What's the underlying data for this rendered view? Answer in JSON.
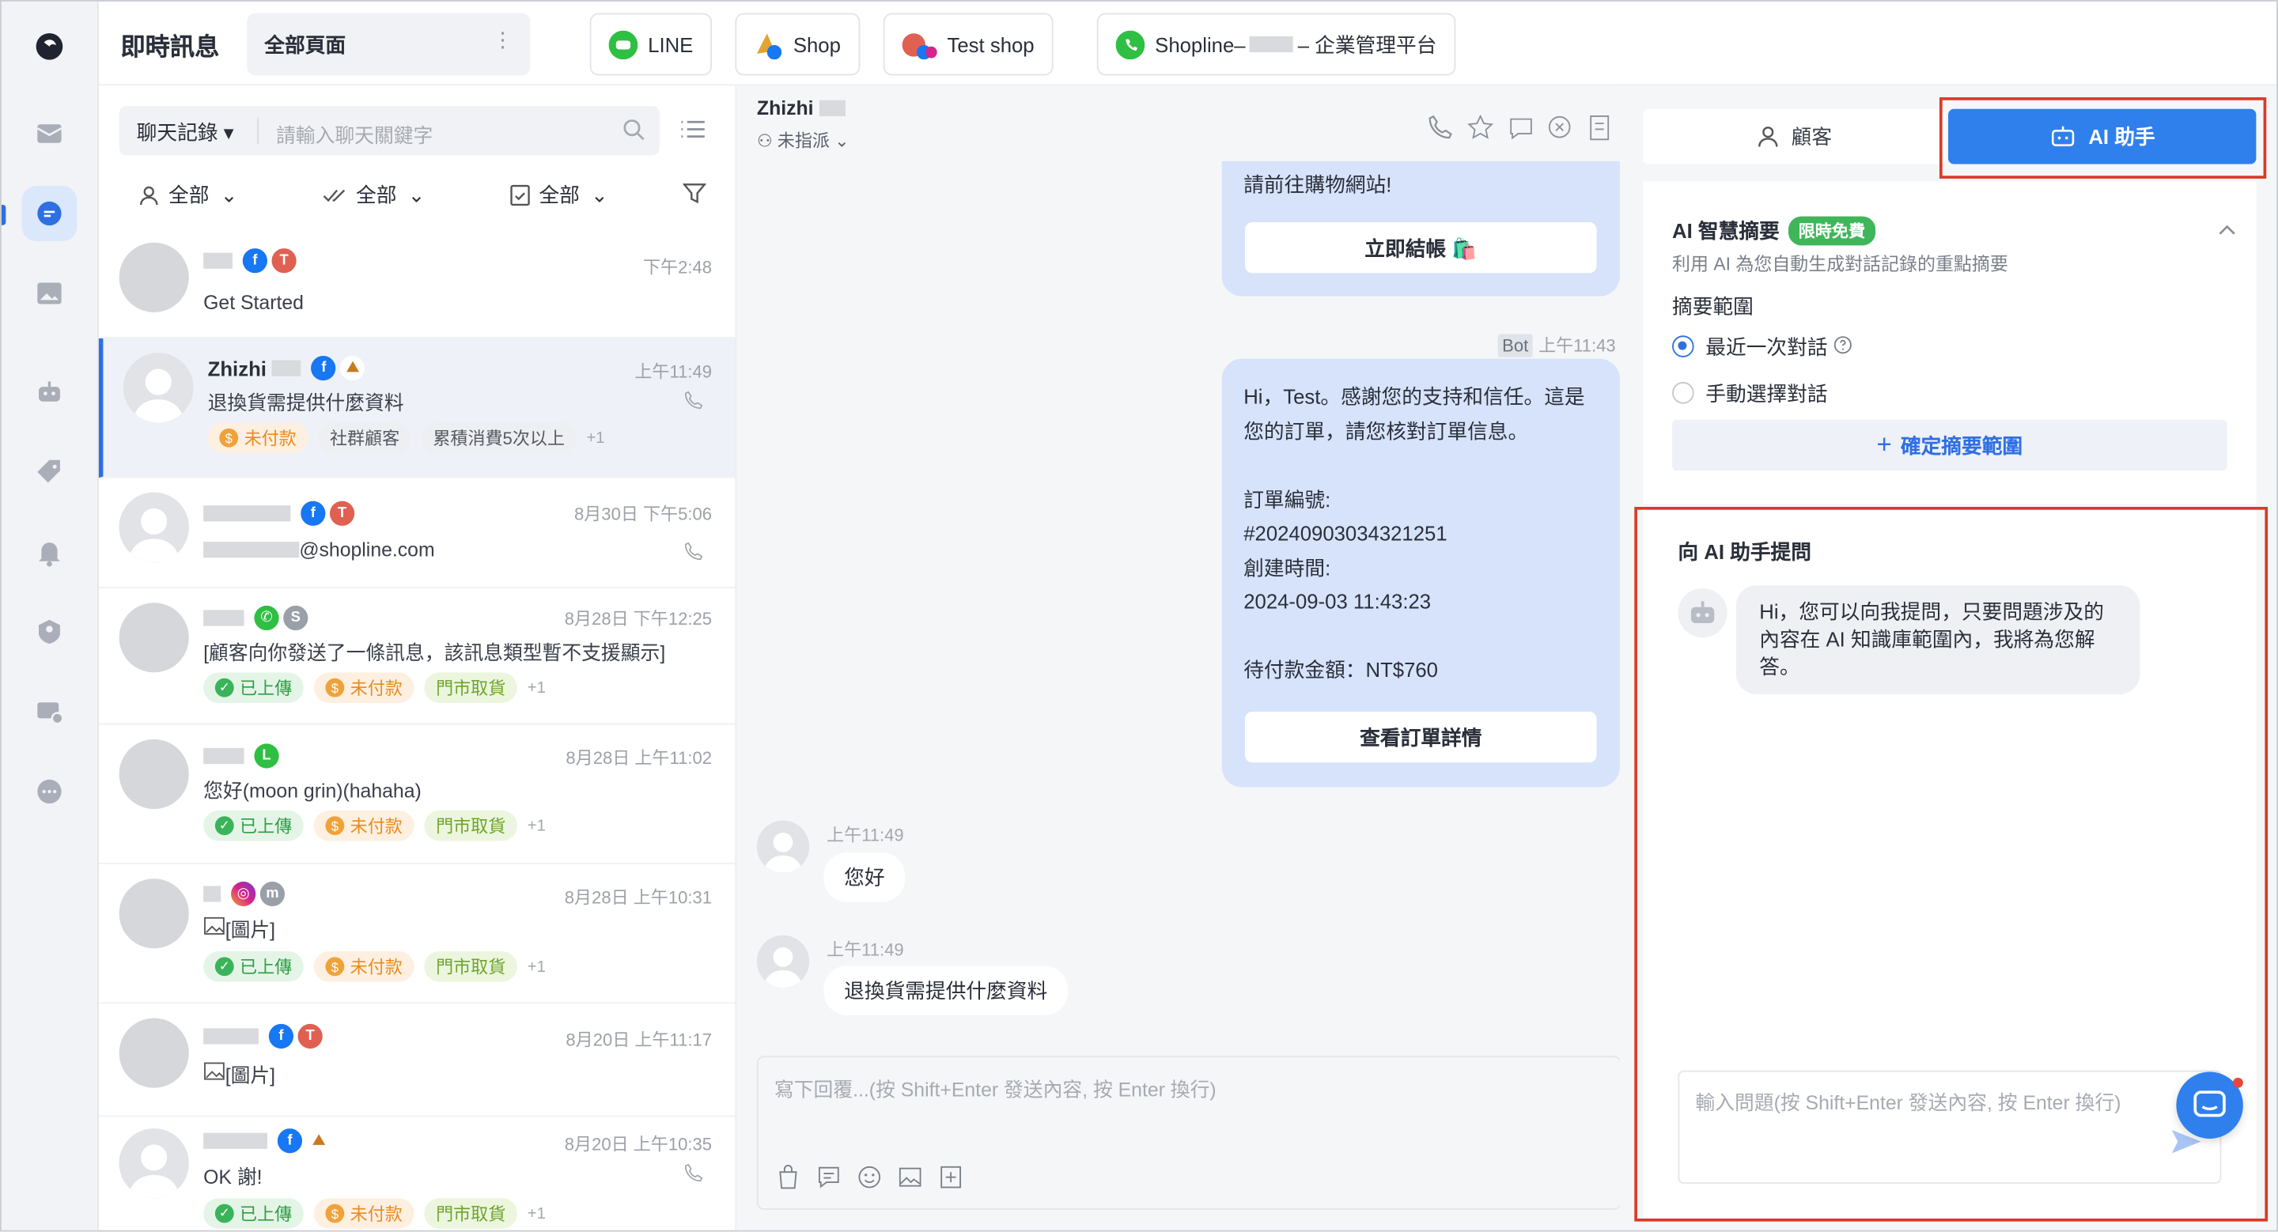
{
  "header": {
    "app_title": "即時訊息",
    "page_select": "全部頁面",
    "page_select_icon": "kebab-icon",
    "channel_tabs": [
      {
        "label": "LINE"
      },
      {
        "label": "Shop"
      },
      {
        "label": "Test shop"
      },
      {
        "label": "Shopline– ",
        "suffix": " – 企業管理平台"
      }
    ]
  },
  "list": {
    "search_type": "聊天記錄",
    "search_placeholder": "請輸入聊天關鍵字",
    "filters": [
      "全部",
      "全部",
      "全部"
    ],
    "rows": [
      {
        "name": "",
        "time": "下午2:48",
        "message": "Get Started"
      },
      {
        "name": "Zhizhi",
        "time": "上午11:49",
        "message": "退換貨需提供什麼資料",
        "tags": [
          "未付款",
          "社群顧客",
          "累積消費5次以上"
        ],
        "more": "+1"
      },
      {
        "name": "",
        "time": "8月30日 下午5:06",
        "message": "@shopline.com"
      },
      {
        "name": "",
        "time": "8月28日 下午12:25",
        "message": "[顧客向你發送了一條訊息，該訊息類型暫不支援顯示]",
        "tags": [
          "已上傳",
          "未付款",
          "門市取貨"
        ],
        "more": "+1"
      },
      {
        "name": "",
        "time": "8月28日 上午11:02",
        "message": "您好(moon grin)(hahaha)",
        "tags": [
          "已上傳",
          "未付款",
          "門市取貨"
        ],
        "more": "+1"
      },
      {
        "name": "",
        "time": "8月28日 上午10:31",
        "message": "[圖片]",
        "tags": [
          "已上傳",
          "未付款",
          "門市取貨"
        ],
        "more": "+1"
      },
      {
        "name": "",
        "time": "8月20日 上午11:17",
        "message": "[圖片]"
      },
      {
        "name": "",
        "time": "8月20日 上午10:35",
        "message": "OK 謝!",
        "tags": [
          "已上傳",
          "未付款",
          "門市取貨"
        ],
        "more": "+1"
      }
    ]
  },
  "chat": {
    "name": "Zhizhi",
    "assign": "未指派",
    "msg1_text": "請前往購物網站!",
    "msg1_button": "立即結帳 🛍️",
    "bot_label": "Bot",
    "bot_time": "上午11:43",
    "msg2_lines": [
      "Hi，Test。感謝您的支持和信任。這是",
      "您的訂單，請您核對訂單信息。",
      "",
      "訂單編號:",
      "#20240903034321251",
      "創建時間:",
      "2024-09-03 11:43:23",
      "",
      "待付款金額：NT$760"
    ],
    "msg2_button": "查看訂單詳情",
    "in1_time": "上午11:49",
    "in1_text": "您好",
    "in2_time": "上午11:49",
    "in2_text": "退換貨需提供什麼資料",
    "composer_placeholder": "寫下回覆...(按 Shift+Enter 發送內容, 按 Enter 換行)"
  },
  "right": {
    "tab_customer": "顧客",
    "tab_ai": "AI 助手",
    "summary_title": "AI 智慧摘要",
    "summary_badge": "限時免費",
    "summary_desc": "利用 AI 為您自動生成對話記錄的重點摘要",
    "range_label": "摘要範圍",
    "range_opt1": "最近一次對話",
    "range_opt2": "手動選擇對話",
    "confirm_label": "確定摘要範圍",
    "ask_title": "向 AI 助手提問",
    "bot_message": "Hi，您可以向我提問，只要問題涉及的內容在 AI 知識庫範圍內，我將為您解答。",
    "ask_placeholder": "輸入問題(按 Shift+Enter 發送內容, 按 Enter 換行)"
  },
  "colors": {
    "accent": "#2f80ed",
    "highlight": "#d93a2b",
    "selected_bg": "#eef1f7"
  }
}
